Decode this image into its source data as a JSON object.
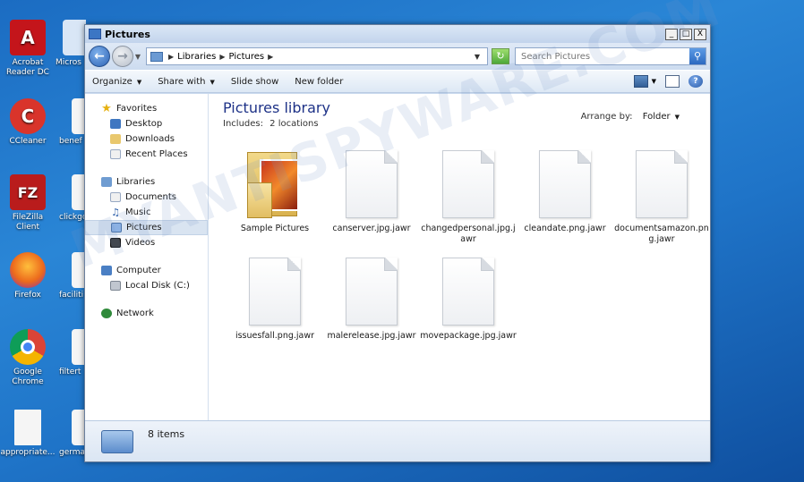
{
  "desktop": {
    "icons": [
      {
        "label": "Acrobat Reader DC",
        "icon": "acrobat-icon",
        "color": "#c4151b",
        "glyph": "A"
      },
      {
        "label": "CCleaner",
        "icon": "ccleaner-icon",
        "color": "#d9342b",
        "glyph": "C"
      },
      {
        "label": "FileZilla Client",
        "icon": "filezilla-icon",
        "color": "#b91c1c",
        "glyph": "FZ"
      },
      {
        "label": "Firefox",
        "icon": "firefox-icon",
        "color": "#ec6a1c",
        "glyph": "🦊"
      },
      {
        "label": "Google Chrome",
        "icon": "chrome-icon",
        "color": "#2f9e44",
        "glyph": "◉"
      },
      {
        "label": "appropriate...",
        "icon": "file-icon",
        "color": "#f5f5f5",
        "glyph": ""
      }
    ],
    "partial_icons": [
      "Micros",
      "benef",
      "clickgo",
      "faciliti",
      "filtert",
      "germa"
    ]
  },
  "window": {
    "title": "Pictures",
    "min": "_",
    "max": "□",
    "close": "X"
  },
  "address": {
    "crumbs": [
      "Libraries",
      "Pictures"
    ],
    "search_placeholder": "Search Pictures"
  },
  "toolbar": {
    "organize": "Organize",
    "share_with": "Share with",
    "slide_show": "Slide show",
    "new_folder": "New folder"
  },
  "nav": {
    "favorites": "Favorites",
    "desktop": "Desktop",
    "downloads": "Downloads",
    "recent_places": "Recent Places",
    "libraries": "Libraries",
    "documents": "Documents",
    "music": "Music",
    "pictures": "Pictures",
    "videos": "Videos",
    "computer": "Computer",
    "local_disk": "Local Disk (C:)",
    "network": "Network"
  },
  "main": {
    "title": "Pictures library",
    "includes_label": "Includes:",
    "includes_value": "2 locations",
    "arrange_label": "Arrange by:",
    "arrange_value": "Folder",
    "files": [
      {
        "name": "Sample Pictures",
        "type": "folder"
      },
      {
        "name": "canserver.jpg.jawr",
        "type": "doc"
      },
      {
        "name": "changedpersonal.jpg.jawr",
        "type": "doc"
      },
      {
        "name": "cleandate.png.jawr",
        "type": "doc"
      },
      {
        "name": "documentsamazon.png.jawr",
        "type": "doc"
      },
      {
        "name": "issuesfall.png.jawr",
        "type": "doc"
      },
      {
        "name": "malerelease.jpg.jawr",
        "type": "doc"
      },
      {
        "name": "movepackage.jpg.jawr",
        "type": "doc"
      }
    ]
  },
  "status": {
    "count": "8 items"
  },
  "watermark": "MYANTISPYWARE.COM"
}
